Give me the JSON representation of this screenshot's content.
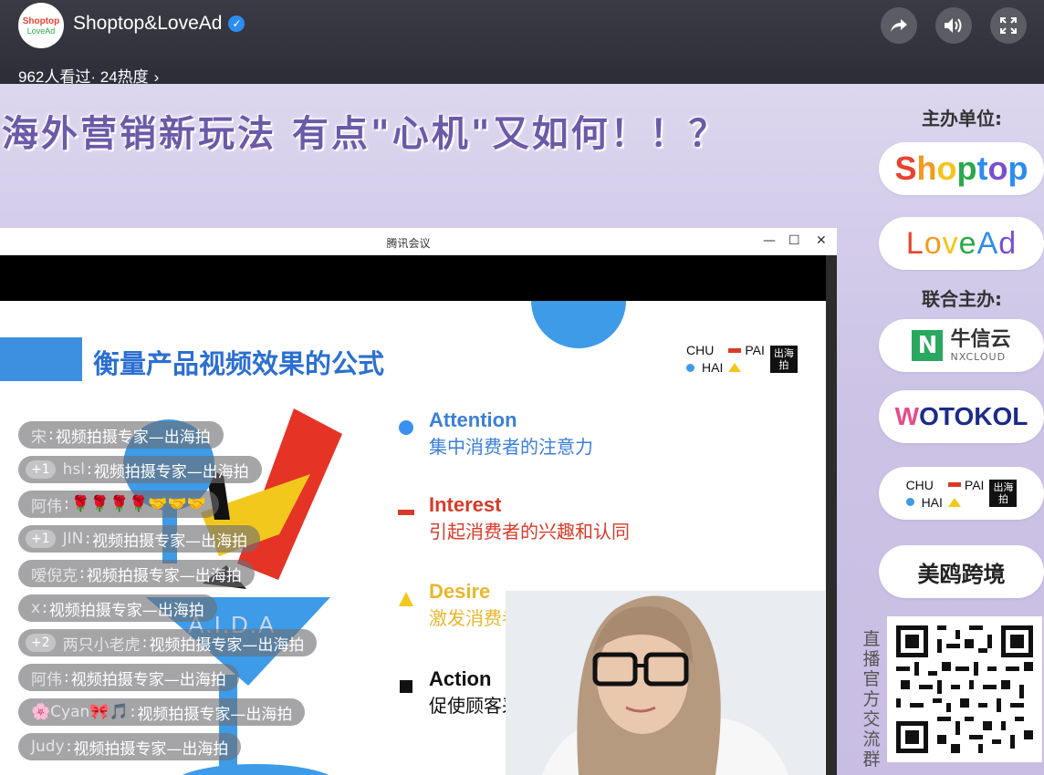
{
  "header": {
    "avatar_line1": "Shoptop",
    "avatar_line2": "LoveAd",
    "channel_name": "Shoptop&LoveAd",
    "viewers": "962人看过· 24热度",
    "chevron": "›"
  },
  "icons": {
    "share": "share-icon",
    "volume": "volume-icon",
    "fullscreen": "fullscreen-icon",
    "verified": "verified-badge-icon"
  },
  "banner": {
    "text": "海外营销新玩法 有点\"心机\"又如何！！？"
  },
  "sponsors": {
    "host_label": "主办单位:",
    "cohost_label": "联合主办:",
    "logos": {
      "shoptop": "Shoptop",
      "lovead": "LovеAd",
      "nx_cn": "牛信云",
      "nx_en": "NXCLOUD",
      "wotokol": "OTOKOL",
      "meiou": "美鸥跨境"
    },
    "qr_caption": "直播官方交流群"
  },
  "meeting_window": {
    "title": "腾讯会议",
    "minimize": "—",
    "maximize": "☐",
    "close": "✕"
  },
  "slide": {
    "title": "衡量产品视频效果的公式",
    "brand": {
      "chu": "CHU",
      "pai": "PAI",
      "hai": "HAI",
      "box_text": "出海拍"
    },
    "aida_label": "A.I.D.A",
    "items": [
      {
        "en": "Attention",
        "cn": "集中消费者的注意力",
        "color": "#3a7fd8",
        "bullet": "circle"
      },
      {
        "en": "Interest",
        "cn": "引起消费者的兴趣和认同",
        "color": "#d83a2a",
        "bullet": "dash"
      },
      {
        "en": "Desire",
        "cn": "激发消费者的购买",
        "color": "#e9b72c",
        "bullet": "triangle"
      },
      {
        "en": "Action",
        "cn": "促使顾客采取购买",
        "color": "#111111",
        "bullet": "square"
      }
    ]
  },
  "chat": {
    "messages": [
      {
        "badge": "",
        "name": "宋",
        "text": "视频拍摄专家—出海拍"
      },
      {
        "badge": "+1",
        "name": "hsl",
        "text": "视频拍摄专家—出海拍"
      },
      {
        "badge": "",
        "name": "阿伟",
        "text": "🌹🌹🌹🌹🤝🤝🤝"
      },
      {
        "badge": "+1",
        "name": "JIN",
        "text": "视频拍摄专家—出海拍"
      },
      {
        "badge": "",
        "name": "嗳倪克",
        "text": "视频拍摄专家—出海拍"
      },
      {
        "badge": "",
        "name": "x",
        "text": "视频拍摄专家—出海拍"
      },
      {
        "badge": "+2",
        "name": "两只小老虎",
        "text": "视频拍摄专家—出海拍"
      },
      {
        "badge": "",
        "name": "阿伟",
        "text": "视频拍摄专家—出海拍"
      },
      {
        "badge": "",
        "name": "🌸Cyan🎀🎵",
        "text": "视频拍摄专家—出海拍"
      },
      {
        "badge": "",
        "name": "Judy",
        "text": "视频拍摄专家—出海拍"
      }
    ]
  },
  "colors": {
    "slide_blue": "#2b6fd1",
    "accent_blue": "#3d8fe0",
    "banner_purple": "#6c5aa8"
  }
}
